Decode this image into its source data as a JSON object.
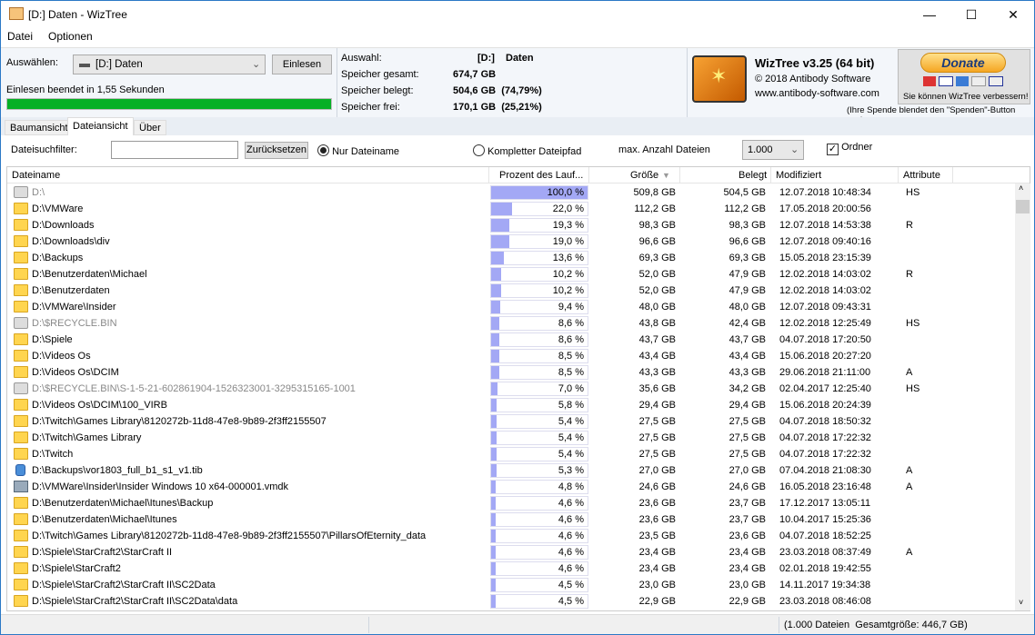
{
  "window": {
    "title": "[D:] Daten  - WizTree",
    "minimize": "—",
    "maximize": "☐",
    "close": "✕"
  },
  "menu": [
    "Datei",
    "Optionen"
  ],
  "selector": {
    "label": "Auswählen:",
    "drive": "[D:] Daten",
    "scan_button": "Einlesen",
    "status": "Einlesen beendet in 1,55 Sekunden",
    "progress_percent": 100
  },
  "summary": {
    "selection_label": "Auswahl:",
    "selection_drive": "[D:]",
    "selection_name": "Daten",
    "total_label": "Speicher gesamt:",
    "total": "674,7 GB",
    "used_label": "Speicher belegt:",
    "used": "504,6 GB  (74,79%)",
    "free_label": "Speicher frei:",
    "free": "170,1 GB  (25,21%)"
  },
  "about": {
    "name": "WizTree v3.25 (64 bit)",
    "copyright": "© 2018 Antibody Software",
    "url": "www.antibody-software.com",
    "donate": "Donate",
    "donate_text": "Sie können WizTree verbessern!",
    "donate_note": "(Ihre Spende blendet den \"Spenden\"-Button aus)"
  },
  "tabs": [
    "Baumansicht",
    "Dateiansicht",
    "Über"
  ],
  "active_tab": 1,
  "filter": {
    "label": "Dateisuchfilter:",
    "value": "",
    "reset": "Zurücksetzen",
    "opt_name": "Nur Dateiname",
    "opt_path": "Kompletter Dateipfad",
    "max_label": "max. Anzahl Dateien",
    "max_value": "1.000",
    "folders_label": "Ordner",
    "folders_checked": true
  },
  "columns": [
    "Dateiname",
    "Prozent des Lauf...",
    "Größe",
    "Belegt",
    "Modifiziert",
    "Attribute"
  ],
  "rows": [
    {
      "icon": "sys",
      "name": "D:\\",
      "pct": "100,0 %",
      "p": 100,
      "size": "509,8 GB",
      "used": "504,5 GB",
      "mod": "12.07.2018 10:48:34",
      "attr": "HS"
    },
    {
      "icon": "folder",
      "name": "D:\\VMWare",
      "pct": "22,0 %",
      "p": 22,
      "size": "112,2 GB",
      "used": "112,2 GB",
      "mod": "17.05.2018 20:00:56",
      "attr": ""
    },
    {
      "icon": "folder",
      "name": "D:\\Downloads",
      "pct": "19,3 %",
      "p": 19.3,
      "size": "98,3 GB",
      "used": "98,3 GB",
      "mod": "12.07.2018 14:53:38",
      "attr": "R"
    },
    {
      "icon": "folder",
      "name": "D:\\Downloads\\div",
      "pct": "19,0 %",
      "p": 19,
      "size": "96,6 GB",
      "used": "96,6 GB",
      "mod": "12.07.2018 09:40:16",
      "attr": ""
    },
    {
      "icon": "folder",
      "name": "D:\\Backups",
      "pct": "13,6 %",
      "p": 13.6,
      "size": "69,3 GB",
      "used": "69,3 GB",
      "mod": "15.05.2018 23:15:39",
      "attr": ""
    },
    {
      "icon": "folder",
      "name": "D:\\Benutzerdaten\\Michael",
      "pct": "10,2 %",
      "p": 10.2,
      "size": "52,0 GB",
      "used": "47,9 GB",
      "mod": "12.02.2018 14:03:02",
      "attr": "R"
    },
    {
      "icon": "folder",
      "name": "D:\\Benutzerdaten",
      "pct": "10,2 %",
      "p": 10.2,
      "size": "52,0 GB",
      "used": "47,9 GB",
      "mod": "12.02.2018 14:03:02",
      "attr": ""
    },
    {
      "icon": "folder",
      "name": "D:\\VMWare\\Insider",
      "pct": "9,4 %",
      "p": 9.4,
      "size": "48,0 GB",
      "used": "48,0 GB",
      "mod": "12.07.2018 09:43:31",
      "attr": ""
    },
    {
      "icon": "sys",
      "name": "D:\\$RECYCLE.BIN",
      "pct": "8,6 %",
      "p": 8.6,
      "size": "43,8 GB",
      "used": "42,4 GB",
      "mod": "12.02.2018 12:25:49",
      "attr": "HS"
    },
    {
      "icon": "folder",
      "name": "D:\\Spiele",
      "pct": "8,6 %",
      "p": 8.6,
      "size": "43,7 GB",
      "used": "43,7 GB",
      "mod": "04.07.2018 17:20:50",
      "attr": ""
    },
    {
      "icon": "folder",
      "name": "D:\\Videos Os",
      "pct": "8,5 %",
      "p": 8.5,
      "size": "43,4 GB",
      "used": "43,4 GB",
      "mod": "15.06.2018 20:27:20",
      "attr": ""
    },
    {
      "icon": "folder",
      "name": "D:\\Videos Os\\DCIM",
      "pct": "8,5 %",
      "p": 8.5,
      "size": "43,3 GB",
      "used": "43,3 GB",
      "mod": "29.06.2018 21:11:00",
      "attr": "A"
    },
    {
      "icon": "sys",
      "name": "D:\\$RECYCLE.BIN\\S-1-5-21-602861904-1526323001-3295315165-1001",
      "pct": "7,0 %",
      "p": 7,
      "size": "35,6 GB",
      "used": "34,2 GB",
      "mod": "02.04.2017 12:25:40",
      "attr": "HS"
    },
    {
      "icon": "folder",
      "name": "D:\\Videos Os\\DCIM\\100_VIRB",
      "pct": "5,8 %",
      "p": 5.8,
      "size": "29,4 GB",
      "used": "29,4 GB",
      "mod": "15.06.2018 20:24:39",
      "attr": ""
    },
    {
      "icon": "folder",
      "name": "D:\\Twitch\\Games Library\\8120272b-11d8-47e8-9b89-2f3ff2155507",
      "pct": "5,4 %",
      "p": 5.4,
      "size": "27,5 GB",
      "used": "27,5 GB",
      "mod": "04.07.2018 18:50:32",
      "attr": ""
    },
    {
      "icon": "folder",
      "name": "D:\\Twitch\\Games Library",
      "pct": "5,4 %",
      "p": 5.4,
      "size": "27,5 GB",
      "used": "27,5 GB",
      "mod": "04.07.2018 17:22:32",
      "attr": ""
    },
    {
      "icon": "folder",
      "name": "D:\\Twitch",
      "pct": "5,4 %",
      "p": 5.4,
      "size": "27,5 GB",
      "used": "27,5 GB",
      "mod": "04.07.2018 17:22:32",
      "attr": ""
    },
    {
      "icon": "tib",
      "name": "D:\\Backups\\vor1803_full_b1_s1_v1.tib",
      "pct": "5,3 %",
      "p": 5.3,
      "size": "27,0 GB",
      "used": "27,0 GB",
      "mod": "07.04.2018 21:08:30",
      "attr": "A"
    },
    {
      "icon": "vmdk",
      "name": "D:\\VMWare\\Insider\\Insider Windows 10 x64-000001.vmdk",
      "pct": "4,8 %",
      "p": 4.8,
      "size": "24,6 GB",
      "used": "24,6 GB",
      "mod": "16.05.2018 23:16:48",
      "attr": "A"
    },
    {
      "icon": "folder",
      "name": "D:\\Benutzerdaten\\Michael\\Itunes\\Backup",
      "pct": "4,6 %",
      "p": 4.6,
      "size": "23,6 GB",
      "used": "23,7 GB",
      "mod": "17.12.2017 13:05:11",
      "attr": ""
    },
    {
      "icon": "folder",
      "name": "D:\\Benutzerdaten\\Michael\\Itunes",
      "pct": "4,6 %",
      "p": 4.6,
      "size": "23,6 GB",
      "used": "23,7 GB",
      "mod": "10.04.2017 15:25:36",
      "attr": ""
    },
    {
      "icon": "folder",
      "name": "D:\\Twitch\\Games Library\\8120272b-11d8-47e8-9b89-2f3ff2155507\\PillarsOfEternity_data",
      "pct": "4,6 %",
      "p": 4.6,
      "size": "23,5 GB",
      "used": "23,6 GB",
      "mod": "04.07.2018 18:52:25",
      "attr": ""
    },
    {
      "icon": "folder",
      "name": "D:\\Spiele\\StarCraft2\\StarCraft II",
      "pct": "4,6 %",
      "p": 4.6,
      "size": "23,4 GB",
      "used": "23,4 GB",
      "mod": "23.03.2018 08:37:49",
      "attr": "A"
    },
    {
      "icon": "folder",
      "name": "D:\\Spiele\\StarCraft2",
      "pct": "4,6 %",
      "p": 4.6,
      "size": "23,4 GB",
      "used": "23,4 GB",
      "mod": "02.01.2018 19:42:55",
      "attr": ""
    },
    {
      "icon": "folder",
      "name": "D:\\Spiele\\StarCraft2\\StarCraft II\\SC2Data",
      "pct": "4,5 %",
      "p": 4.5,
      "size": "23,0 GB",
      "used": "23,0 GB",
      "mod": "14.11.2017 19:34:38",
      "attr": ""
    },
    {
      "icon": "folder",
      "name": "D:\\Spiele\\StarCraft2\\StarCraft II\\SC2Data\\data",
      "pct": "4,5 %",
      "p": 4.5,
      "size": "22,9 GB",
      "used": "22,9 GB",
      "mod": "23.03.2018 08:46:08",
      "attr": ""
    }
  ],
  "statusbar": "(1.000 Dateien  Gesamtgröße: 446,7 GB)",
  "colors": {
    "progress": "#06b025",
    "percent_bar": "#a3a8f5",
    "folder": "#ffd54f"
  }
}
